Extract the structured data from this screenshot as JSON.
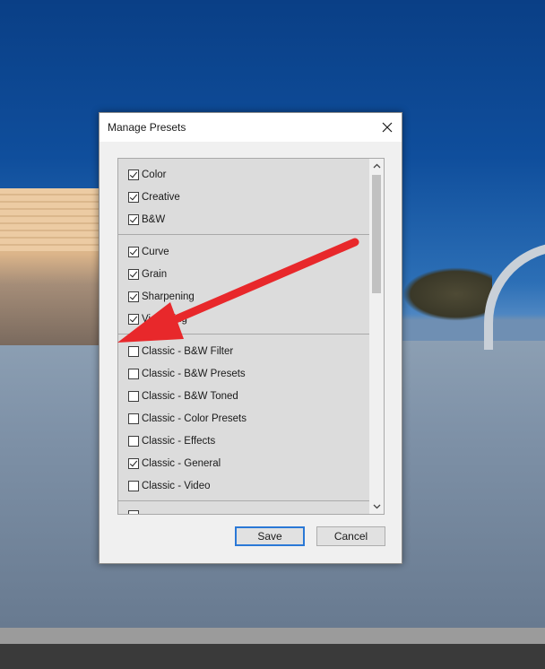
{
  "dialog": {
    "title": "Manage Presets",
    "groups": [
      {
        "items": [
          {
            "label": "Color",
            "checked": true
          },
          {
            "label": "Creative",
            "checked": true
          },
          {
            "label": "B&W",
            "checked": true
          }
        ]
      },
      {
        "items": [
          {
            "label": "Curve",
            "checked": true
          },
          {
            "label": "Grain",
            "checked": true
          },
          {
            "label": "Sharpening",
            "checked": true
          },
          {
            "label": "Vignetting",
            "checked": true
          }
        ]
      },
      {
        "items": [
          {
            "label": "Classic - B&W Filter",
            "checked": false
          },
          {
            "label": "Classic - B&W Presets",
            "checked": false
          },
          {
            "label": "Classic - B&W Toned",
            "checked": false
          },
          {
            "label": "Classic - Color Presets",
            "checked": false
          },
          {
            "label": "Classic - Effects",
            "checked": false
          },
          {
            "label": "Classic - General",
            "checked": true
          },
          {
            "label": "Classic - Video",
            "checked": false
          }
        ]
      }
    ],
    "save_label": "Save",
    "cancel_label": "Cancel"
  },
  "colors": {
    "annotation_arrow": "#e8282b",
    "default_button_border": "#2a78d6"
  },
  "icons": {
    "close": "close-icon",
    "scroll_up": "chevron-up-icon",
    "scroll_down": "chevron-down-icon"
  }
}
